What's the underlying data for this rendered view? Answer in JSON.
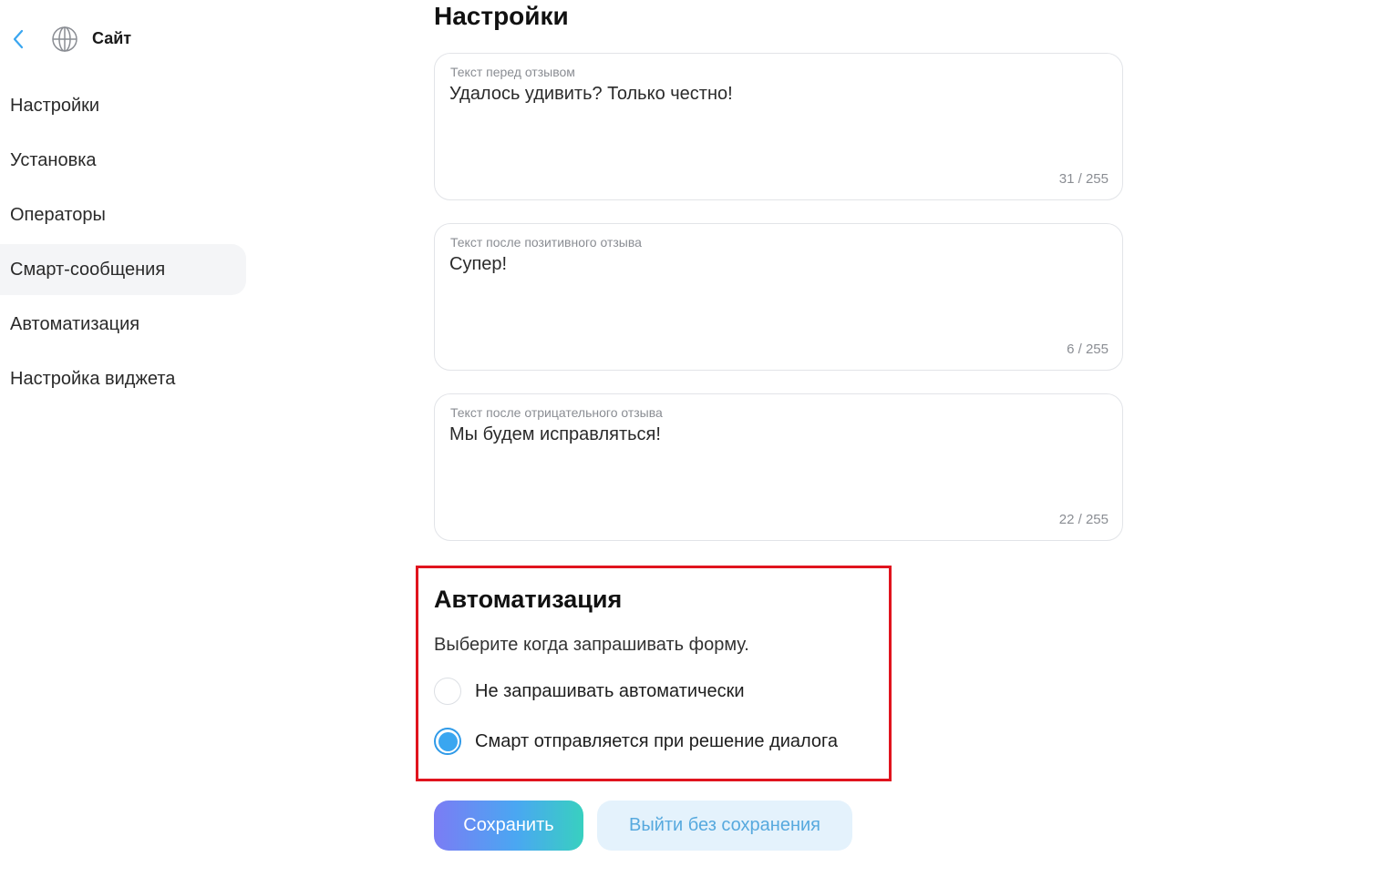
{
  "sidebar": {
    "back_icon": "chevron-left-icon",
    "site_icon": "globe-icon",
    "title": "Сайт",
    "items": [
      {
        "label": "Настройки"
      },
      {
        "label": "Установка"
      },
      {
        "label": "Операторы"
      },
      {
        "label": "Смарт-сообщения"
      },
      {
        "label": "Автоматизация"
      },
      {
        "label": "Настройка виджета"
      }
    ],
    "active_item": "Смарт-сообщения"
  },
  "main": {
    "title": "Настройки",
    "fields": [
      {
        "label": "Текст перед отзывом",
        "value": "Удалось удивить? Только честно!",
        "counter": "31 / 255"
      },
      {
        "label": "Текст после позитивного отзыва",
        "value": "Супер!",
        "counter": "6 / 255"
      },
      {
        "label": "Текст после отрицательного отзыва",
        "value": "Мы будем исправляться!",
        "counter": "22 / 255"
      }
    ],
    "automation": {
      "title": "Автоматизация",
      "description": "Выберите когда запрашивать форму.",
      "options": [
        {
          "label": "Не запрашивать автоматически",
          "selected": false
        },
        {
          "label": "Смарт отправляется при решение диалога",
          "selected": true
        }
      ]
    },
    "buttons": {
      "save_label": "Сохранить",
      "exit_label": "Выйти без сохранения"
    }
  },
  "colors": {
    "accent": "#3aa6f0",
    "highlight": "#e0141e",
    "save_gradient": [
      "#7b7cf4",
      "#4aa7f2",
      "#38d0c0"
    ],
    "exit_bg": "#e4f2fc"
  }
}
